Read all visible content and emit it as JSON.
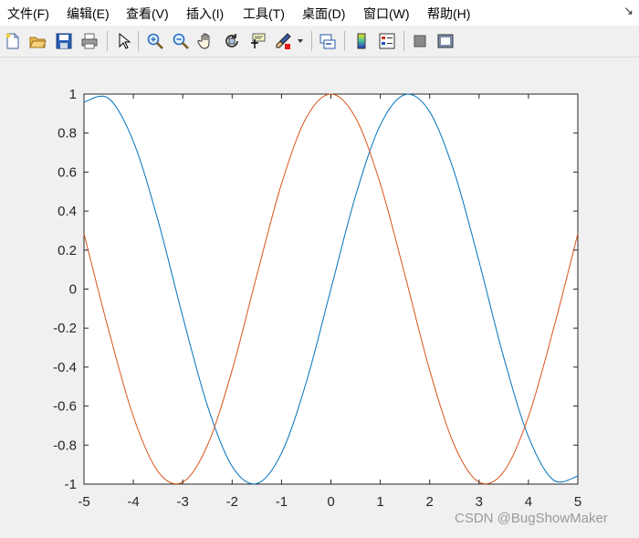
{
  "menu": {
    "items": [
      {
        "label": "文件(F)"
      },
      {
        "label": "编辑(E)"
      },
      {
        "label": "查看(V)"
      },
      {
        "label": "插入(I)"
      },
      {
        "label": "工具(T)"
      },
      {
        "label": "桌面(D)"
      },
      {
        "label": "窗口(W)"
      },
      {
        "label": "帮助(H)"
      }
    ],
    "dock_icon": "↘"
  },
  "toolbar": {
    "icons": [
      "new-file-icon",
      "open-folder-icon",
      "save-icon",
      "print-icon",
      "select-arrow-icon",
      "zoom-in-icon",
      "zoom-out-icon",
      "pan-hand-icon",
      "rotate-3d-icon",
      "data-cursor-icon",
      "brush-icon",
      "dropdown-arrow-icon",
      "link-plot-icon",
      "colorbar-icon",
      "legend-icon",
      "hide-plot-tools-icon",
      "show-plot-tools-icon"
    ]
  },
  "watermark": "CSDN @BugShowMaker",
  "chart_data": {
    "type": "line",
    "title": "",
    "xlabel": "",
    "ylabel": "",
    "xlim": [
      -5,
      5
    ],
    "ylim": [
      -1,
      1
    ],
    "xticks": [
      "-5",
      "-4",
      "-3",
      "-2",
      "-1",
      "0",
      "1",
      "2",
      "3",
      "4",
      "5"
    ],
    "yticks": [
      "-1",
      "-0.8",
      "-0.6",
      "-0.4",
      "-0.2",
      "0",
      "0.2",
      "0.4",
      "0.6",
      "0.8",
      "1"
    ],
    "grid": false,
    "series": [
      {
        "color": "#0072BD",
        "x": [
          -5,
          -4.5,
          -4,
          -3.5,
          -3,
          -2.5,
          -2,
          -1.5,
          -1,
          -0.5,
          0,
          0.5,
          1,
          1.5,
          2,
          2.5,
          3,
          3.5,
          4,
          4.5,
          5
        ],
        "values": [
          0.959,
          0.978,
          0.757,
          0.351,
          -0.141,
          -0.598,
          -0.909,
          -0.997,
          -0.841,
          -0.479,
          0,
          0.479,
          0.841,
          0.997,
          0.909,
          0.598,
          0.141,
          -0.351,
          -0.757,
          -0.978,
          -0.959
        ]
      },
      {
        "color": "#D95319",
        "x": [
          -5,
          -4.5,
          -4,
          -3.5,
          -3,
          -2.5,
          -2,
          -1.5,
          -1,
          -0.5,
          0,
          0.5,
          1,
          1.5,
          2,
          2.5,
          3,
          3.5,
          4,
          4.5,
          5
        ],
        "values": [
          0.284,
          -0.211,
          -0.654,
          -0.936,
          -0.99,
          -0.801,
          -0.416,
          0.071,
          0.54,
          0.878,
          1,
          0.878,
          0.54,
          0.071,
          -0.416,
          -0.801,
          -0.99,
          -0.936,
          -0.654,
          -0.211,
          0.284
        ]
      }
    ]
  }
}
